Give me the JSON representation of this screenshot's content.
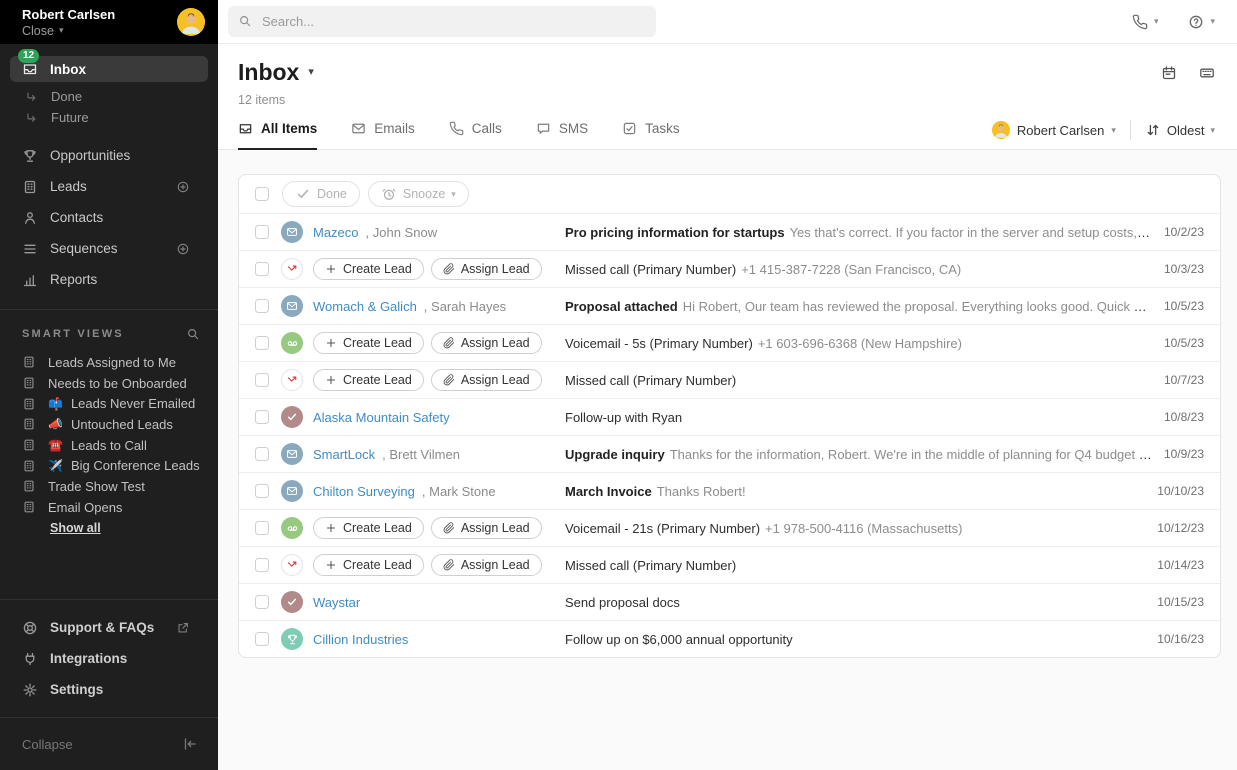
{
  "sidebar": {
    "user": {
      "name": "Robert Carlsen",
      "org": "Close"
    },
    "inbox": {
      "label": "Inbox",
      "badge": "12",
      "icon": "inbox-tray-icon"
    },
    "sub_items": [
      {
        "label": "Done",
        "icon": "branch-arrow-icon"
      },
      {
        "label": "Future",
        "icon": "branch-arrow-icon"
      }
    ],
    "nav": [
      {
        "label": "Opportunities",
        "icon": "trophy-icon",
        "has_add": false
      },
      {
        "label": "Leads",
        "icon": "building-icon",
        "has_add": true
      },
      {
        "label": "Contacts",
        "icon": "person-icon",
        "has_add": false
      },
      {
        "label": "Sequences",
        "icon": "sequence-icon",
        "has_add": true
      },
      {
        "label": "Reports",
        "icon": "bar-chart-icon",
        "has_add": false
      }
    ],
    "smart_views": {
      "title": "SMART VIEWS",
      "search_icon": "search-icon",
      "items": [
        {
          "label": "Leads Assigned to Me",
          "emoji": ""
        },
        {
          "label": "Needs to be Onboarded",
          "emoji": ""
        },
        {
          "label": "Leads Never Emailed",
          "emoji": "📫"
        },
        {
          "label": "Untouched Leads",
          "emoji": "📣"
        },
        {
          "label": "Leads to Call",
          "emoji": "☎️"
        },
        {
          "label": "Big Conference Leads",
          "emoji": "✈️"
        },
        {
          "label": "Trade Show Test",
          "emoji": ""
        },
        {
          "label": "Email Opens",
          "emoji": ""
        }
      ],
      "show_all": "Show all"
    },
    "footer": [
      {
        "label": "Support & FAQs",
        "icon": "life-ring-icon",
        "external": true
      },
      {
        "label": "Integrations",
        "icon": "plug-icon",
        "external": false
      },
      {
        "label": "Settings",
        "icon": "gear-icon",
        "external": false
      }
    ],
    "collapse_label": "Collapse"
  },
  "topbar": {
    "search_placeholder": "Search..."
  },
  "header": {
    "title": "Inbox",
    "items_count": "12 items"
  },
  "tabs": [
    {
      "label": "All Items",
      "icon": "inbox-tray-icon",
      "active": true
    },
    {
      "label": "Emails",
      "icon": "envelope-icon",
      "active": false
    },
    {
      "label": "Calls",
      "icon": "phone-icon",
      "active": false
    },
    {
      "label": "SMS",
      "icon": "speech-bubble-icon",
      "active": false
    },
    {
      "label": "Tasks",
      "icon": "task-check-icon",
      "active": false
    }
  ],
  "filters": {
    "user": "Robert Carlsen",
    "sort": "Oldest"
  },
  "toolbar": {
    "done_label": "Done",
    "snooze_label": "Snooze"
  },
  "table": {
    "create_lead_label": "Create Lead",
    "assign_lead_label": "Assign Lead",
    "colors": {
      "email_avatar": "#8aa9be",
      "voicemail_avatar": "#97c981",
      "task_avatar": "#b38a8a",
      "opportunity_avatar": "#7fccb5",
      "missed_call_arrow": "#d63c3c",
      "link_blue": "#3f8cc5",
      "badge_green": "#2fa357"
    },
    "rows": [
      {
        "type": "email",
        "lead": "Mazeco",
        "contact": "John Snow",
        "subject": "Pro pricing information for startups",
        "preview": "Yes that's correct. If you factor in the server and setup costs, yo…",
        "date": "10/2/23"
      },
      {
        "type": "missed-call",
        "buttons": true,
        "subject": "Missed call (Primary Number)",
        "preview": "+1 415-387-7228 (San Francisco, CA)",
        "date": "10/3/23"
      },
      {
        "type": "email",
        "lead": "Womach & Galich",
        "contact": "Sarah Hayes",
        "subject": "Proposal attached",
        "preview": "Hi Robert, Our team has reviewed the proposal. Everything looks good. Quick que…",
        "date": "10/5/23"
      },
      {
        "type": "voicemail",
        "buttons": true,
        "subject": "Voicemail - 5s (Primary Number)",
        "preview": "+1 603-696-6368 (New Hampshire)",
        "date": "10/5/23"
      },
      {
        "type": "missed-call",
        "buttons": true,
        "subject": "Missed call (Primary Number)",
        "preview": "",
        "date": "10/7/23"
      },
      {
        "type": "task",
        "lead": "Alaska Mountain Safety",
        "subject": "Follow-up with Ryan",
        "preview": "",
        "date": "10/8/23"
      },
      {
        "type": "email",
        "lead": "SmartLock",
        "contact": "Brett Vilmen",
        "subject": "Upgrade inquiry",
        "preview": "Thanks for the information, Robert. We're in the middle of planning for Q4 budget a…",
        "date": "10/9/23"
      },
      {
        "type": "email",
        "lead": "Chilton Surveying",
        "contact": "Mark Stone",
        "subject": "March Invoice",
        "preview": "Thanks Robert!",
        "date": "10/10/23"
      },
      {
        "type": "voicemail",
        "buttons": true,
        "subject": "Voicemail - 21s (Primary Number)",
        "preview": "+1 978-500-4116 (Massachusetts)",
        "date": "10/12/23"
      },
      {
        "type": "missed-call",
        "buttons": true,
        "subject": "Missed call (Primary Number)",
        "preview": "",
        "date": "10/14/23"
      },
      {
        "type": "task",
        "lead": "Waystar",
        "subject": "Send proposal docs",
        "preview": "",
        "date": "10/15/23"
      },
      {
        "type": "opportunity",
        "lead": "Cillion Industries",
        "subject": "Follow up on $6,000 annual opportunity",
        "preview": "",
        "date": "10/16/23"
      }
    ]
  }
}
